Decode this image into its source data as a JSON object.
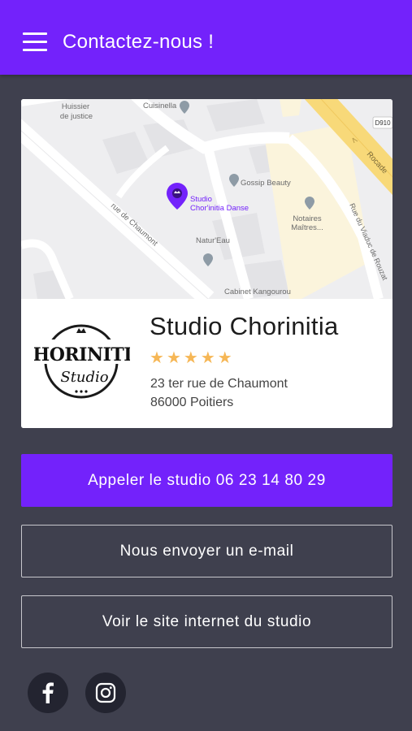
{
  "header": {
    "title": "Contactez-nous !",
    "menu_icon": "hamburger-menu-icon"
  },
  "map": {
    "labels": {
      "huissier": "Huissier",
      "de_justice": "de justice",
      "cuisinella": "Cuisinella",
      "d910": "D910",
      "rocade": "Rocade",
      "gossip": "Gossip Beauty",
      "studio1": "Studio",
      "studio2": "Chor'initia Danse",
      "notaires1": "Notaires",
      "notaires2": "Maîtres...",
      "rue_chaumont": "rue de Chaumont",
      "natureau": "Natur'Eau",
      "rue_viaduc": "Rue du Viaduc de Rouzat",
      "kangourou": "Cabinet Kangourou"
    }
  },
  "business": {
    "name": "Studio Chorinitia",
    "rating": 5,
    "address_line1": "23 ter rue de Chaumont",
    "address_line2": "86000 Poitiers",
    "logo_text": "CHORINITIA",
    "logo_script": "Studio"
  },
  "actions": {
    "call": "Appeler le studio 06 23 14 80 29",
    "email": "Nous envoyer un e-mail",
    "website": "Voir le site internet du studio"
  },
  "social": {
    "facebook_icon": "facebook-icon",
    "instagram_icon": "instagram-icon"
  },
  "colors": {
    "accent": "#7322fb",
    "background": "#3f404e",
    "star": "#f6b756"
  }
}
